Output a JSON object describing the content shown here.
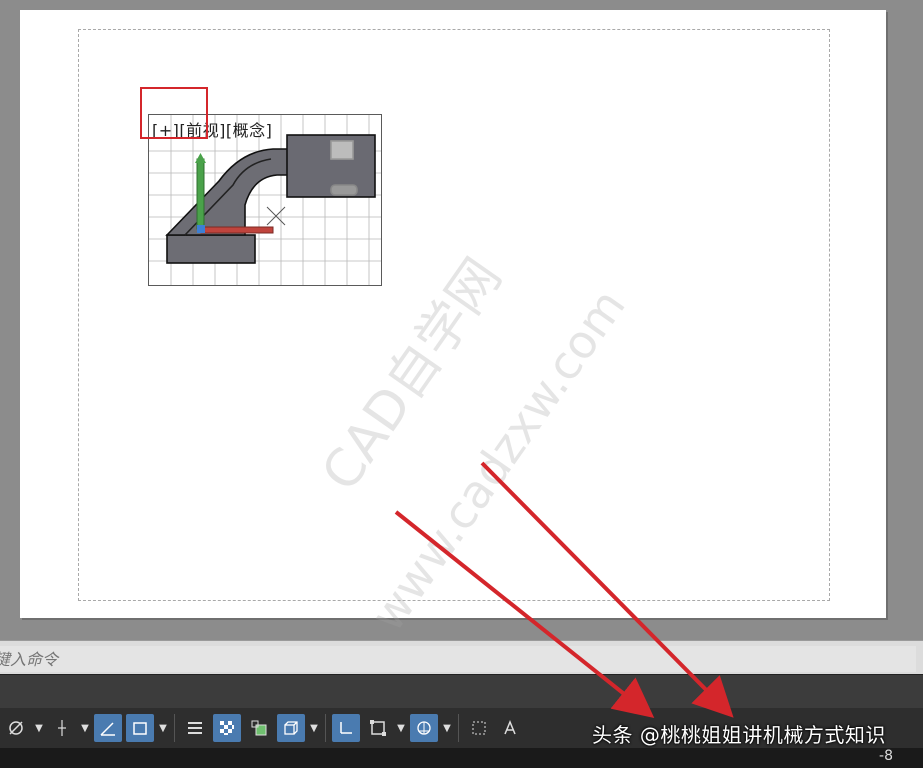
{
  "viewport": {
    "label": "[+][前视][概念]"
  },
  "watermarks": [
    "CAD自学网",
    "www.cadzxw.com"
  ],
  "command_line": {
    "placeholder": "键入命令"
  },
  "status_bar": {
    "icons": [
      "polar-tracking-icon",
      "object-snap-tracking-icon",
      "dynamic-ucs-icon",
      "dynamic-input-icon",
      "lineweight-icon",
      "transparency-icon",
      "selection-cycling-icon",
      "3d-object-snap-icon",
      "gizmo-icon",
      "annotation-monitor-icon",
      "units-icon",
      "quick-properties-icon",
      "annotation-scale-icon",
      "workspace-icon",
      "customize-icon"
    ]
  },
  "overlay": {
    "text": "头条 @桃桃姐姐讲机械方式知识"
  },
  "bottom_right": {
    "text": "-8"
  },
  "colors": {
    "highlight": "#d4262b",
    "arrow": "#d4262b",
    "active_button": "#4a7bb0"
  }
}
